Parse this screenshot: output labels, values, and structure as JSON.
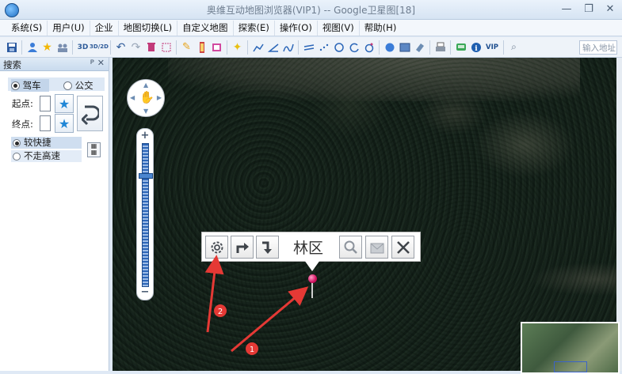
{
  "window": {
    "title": "奥维互动地图浏览器(VIP1) -- Google卫星图[18]",
    "controls": {
      "minimize": "—",
      "restore": "❐",
      "close": "✕"
    }
  },
  "menu": [
    "系统(S)",
    "用户(U)",
    "企业",
    "地图切换(L)",
    "自定义地图",
    "探索(E)",
    "操作(O)",
    "视图(V)",
    "帮助(H)"
  ],
  "toolbar": {
    "btn_3d": "3D",
    "btn_3d2d": "3D/2D",
    "btn_vip": "VIP",
    "search_placeholder": "输入地址"
  },
  "search_panel": {
    "title": "搜索",
    "pin": "ᴘ",
    "close": "✕",
    "mode_drive": "驾车",
    "mode_bus": "公交",
    "start_label": "起点:",
    "end_label": "终点:",
    "option_fast": "较快捷",
    "option_no_highway": "不走高速",
    "selected_mode": "驾车",
    "selected_option": "较快捷"
  },
  "map": {
    "zoom_level": 0.78,
    "popup": {
      "title": "林区"
    },
    "annotations": {
      "marker_1": "1",
      "marker_2": "2"
    }
  },
  "colors": {
    "accent": "#2b66b8",
    "annotation_red": "#e53935",
    "pin": "#d0105e"
  }
}
